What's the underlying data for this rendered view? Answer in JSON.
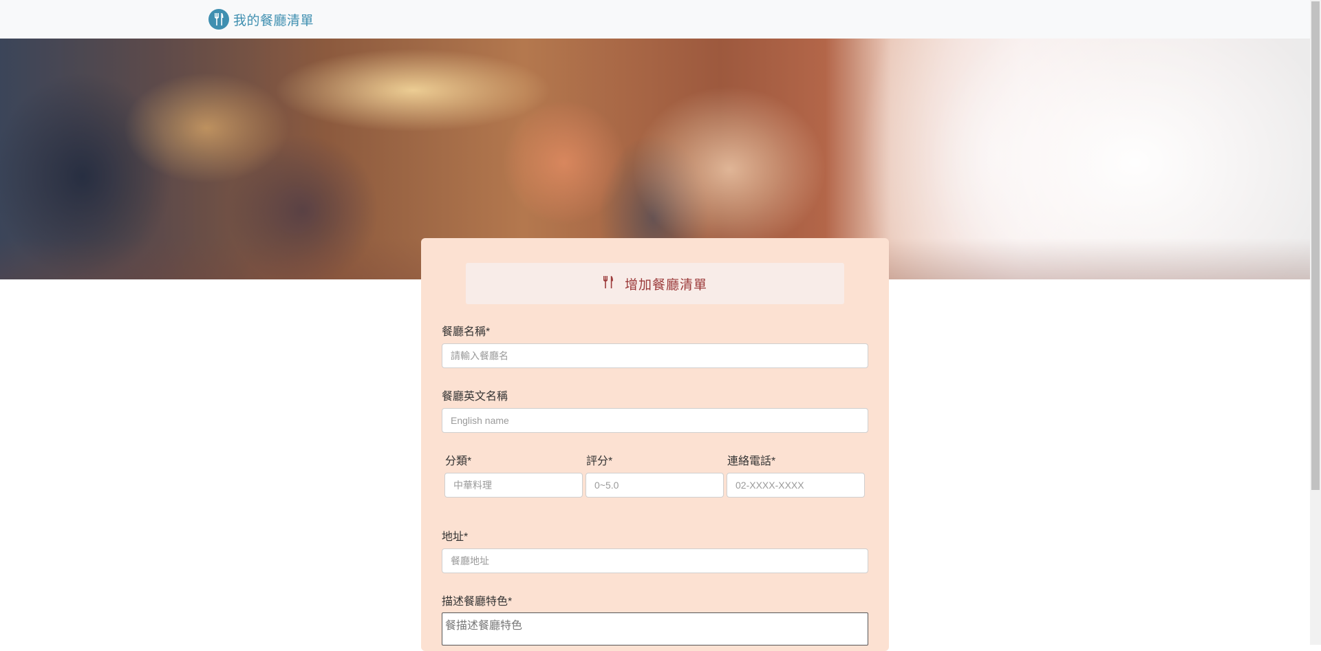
{
  "navbar": {
    "brand_text": "我的餐廳清單",
    "logo_icon": "utensils-icon",
    "brand_color": "#3f8fb0"
  },
  "banner": {
    "description_icon": "restaurant-photo"
  },
  "form": {
    "title_icon": "utensils-icon",
    "title": "增加餐廳清單",
    "title_color": "#9b3a3a",
    "card_color": "#fce1d2",
    "name": {
      "label": "餐廳名稱*",
      "placeholder": "請輸入餐廳名",
      "value": ""
    },
    "name_en": {
      "label": "餐廳英文名稱",
      "placeholder": "English name",
      "value": ""
    },
    "category": {
      "label": "分類*",
      "placeholder": "中華料理",
      "value": ""
    },
    "rating": {
      "label": "評分*",
      "placeholder": "0~5.0",
      "value": ""
    },
    "phone": {
      "label": "連絡電話*",
      "placeholder": "02-XXXX-XXXX",
      "value": ""
    },
    "address": {
      "label": "地址*",
      "placeholder": "餐廳地址",
      "value": ""
    },
    "description": {
      "label": "描述餐廳特色*",
      "placeholder": "餐描述餐廳特色",
      "value": ""
    }
  }
}
